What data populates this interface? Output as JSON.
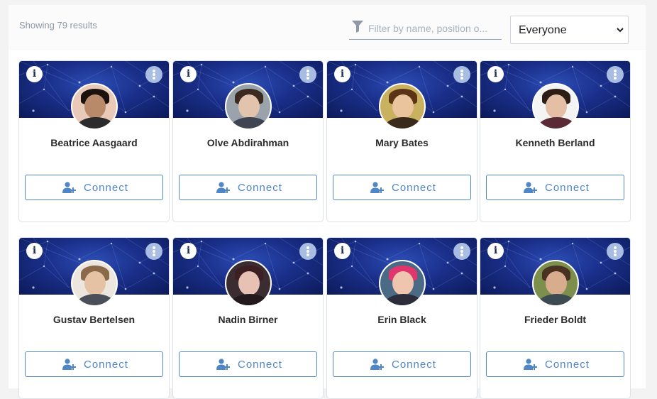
{
  "header": {
    "results_text": "Showing 79 results",
    "filter_placeholder": "Filter by name, position o...",
    "filter_icon": "funnel-icon",
    "audience_select": {
      "selected": "Everyone",
      "icon": "chevron-down-icon"
    }
  },
  "colors": {
    "accent": "#4f86c6",
    "banner": "#1a2f8a",
    "menu_dot_bg": "#a9bde3"
  },
  "cards": [
    {
      "name": "Beatrice Aasgaard",
      "connect_label": "Connect",
      "info_icon": "info-icon",
      "menu_icon": "more-vertical-icon",
      "connect_icon": "add-user-icon",
      "avatar_bg": "#e9c9b7",
      "skin": "#b98a6a",
      "hair": "#1b1210",
      "shirt": "#2b2b2b"
    },
    {
      "name": "Olve Abdirahman",
      "connect_label": "Connect",
      "info_icon": "info-icon",
      "menu_icon": "more-vertical-icon",
      "connect_icon": "add-user-icon",
      "avatar_bg": "#9aa3ab",
      "skin": "#e2c3ad",
      "hair": "#3a2a20",
      "shirt": "#3e4452"
    },
    {
      "name": "Mary Bates",
      "connect_label": "Connect",
      "info_icon": "info-icon",
      "menu_icon": "more-vertical-icon",
      "connect_icon": "add-user-icon",
      "avatar_bg": "#c9b160",
      "skin": "#e9c49c",
      "hair": "#5a3414",
      "shirt": "#3a2a1a"
    },
    {
      "name": "Kenneth Berland",
      "connect_label": "Connect",
      "info_icon": "info-icon",
      "menu_icon": "more-vertical-icon",
      "connect_icon": "add-user-icon",
      "avatar_bg": "#f4f4f4",
      "skin": "#e4bfa6",
      "hair": "#2c1d16",
      "shirt": "#5a2a36"
    },
    {
      "name": "Gustav Bertelsen",
      "connect_label": "Connect",
      "info_icon": "info-icon",
      "menu_icon": "more-vertical-icon",
      "connect_icon": "add-user-icon",
      "avatar_bg": "#ece6de",
      "skin": "#e6c2a4",
      "hair": "#8a6a4a",
      "shirt": "#4a4f5a"
    },
    {
      "name": "Nadin Birner",
      "connect_label": "Connect",
      "info_icon": "info-icon",
      "menu_icon": "more-vertical-icon",
      "connect_icon": "add-user-icon",
      "avatar_bg": "#3a2c30",
      "skin": "#e7c2b4",
      "hair": "#3b1f22",
      "shirt": "#241a1e"
    },
    {
      "name": "Erin Black",
      "connect_label": "Connect",
      "info_icon": "info-icon",
      "menu_icon": "more-vertical-icon",
      "connect_icon": "add-user-icon",
      "avatar_bg": "#4a6a86",
      "skin": "#efc5b0",
      "hair": "#e0366d",
      "shirt": "#2c2c3a"
    },
    {
      "name": "Frieder Boldt",
      "connect_label": "Connect",
      "info_icon": "info-icon",
      "menu_icon": "more-vertical-icon",
      "connect_icon": "add-user-icon",
      "avatar_bg": "#7c8f4c",
      "skin": "#d8ad8e",
      "hair": "#4a3222",
      "shirt": "#3c4a52"
    }
  ]
}
